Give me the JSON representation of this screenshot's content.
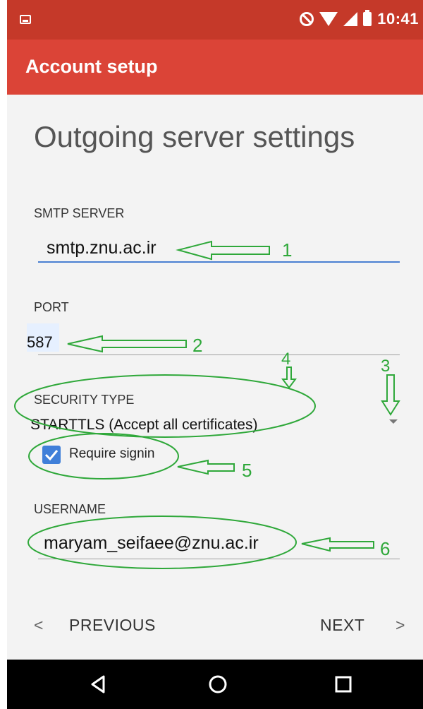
{
  "status_bar": {
    "time": "10:41"
  },
  "app_bar": {
    "title": "Account setup"
  },
  "page": {
    "title": "Outgoing server settings"
  },
  "smtp": {
    "label": "SMTP SERVER",
    "value": "smtp.znu.ac.ir"
  },
  "port": {
    "label": "PORT",
    "value": "587"
  },
  "security": {
    "label": "SECURITY TYPE",
    "value": "STARTTLS (Accept all certificates)"
  },
  "signin": {
    "label": "Require signin",
    "checked": true
  },
  "username": {
    "label": "USERNAME",
    "value": "maryam_seifaee@znu.ac.ir"
  },
  "nav": {
    "previous": "PREVIOUS",
    "next": "NEXT"
  },
  "annotations": {
    "one": "1",
    "two": "2",
    "three": "3",
    "four": "4",
    "five": "5",
    "six": "6"
  },
  "colors": {
    "status_bar": "#c53929",
    "app_bar": "#db4437",
    "accent": "#3f7fd9",
    "annotation": "#2fa83a"
  },
  "icons": [
    "image-icon",
    "do-not-disturb-icon",
    "wifi-icon",
    "signal-icon",
    "battery-icon",
    "back-icon",
    "home-icon",
    "recents-icon"
  ]
}
